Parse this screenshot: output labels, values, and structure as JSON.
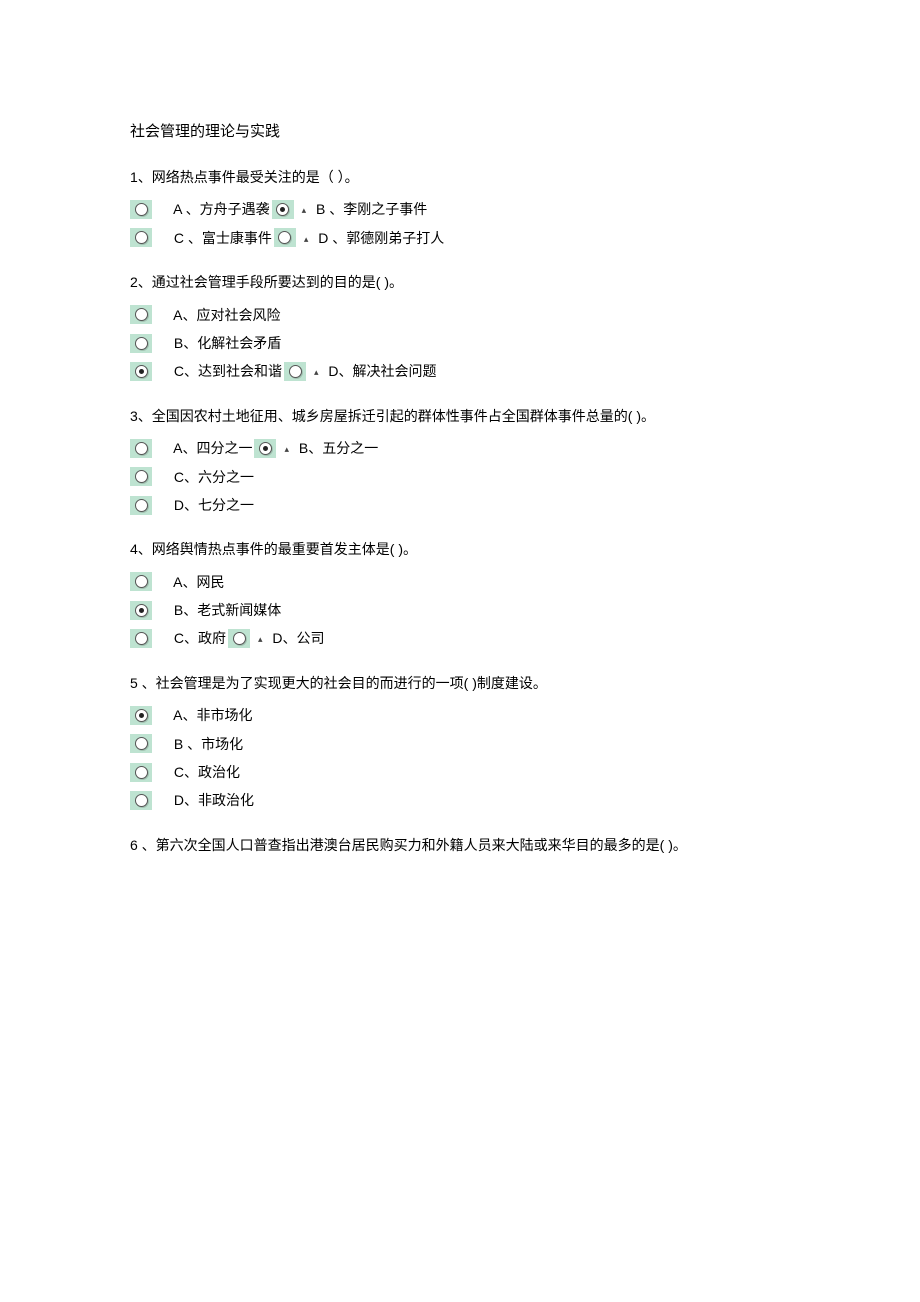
{
  "title": "社会管理的理论与实践",
  "q1": {
    "text": "1、网络热点事件最受关注的是（ ）。",
    "a": " A 、方舟子遇袭",
    "b": " B 、李刚之子事件",
    "c": " C 、富士康事件",
    "d": " D 、郭德刚弟子打人"
  },
  "q2": {
    "text": "2、通过社会管理手段所要达到的目的是( )。",
    "a": " A、应对社会风险",
    "b": " B、化解社会矛盾",
    "c": " C、达到社会和谐",
    "d": " D、解决社会问题"
  },
  "q3": {
    "text": "3、全国因农村土地征用、城乡房屋拆迁引起的群体性事件占全国群体事件总量的( )。",
    "a": " A、四分之一",
    "b": " B、五分之一",
    "c": " C、六分之一",
    "d": " D、七分之一"
  },
  "q4": {
    "text": "4、网络舆情热点事件的最重要首发主体是(   )。",
    "a": " A、网民",
    "b": " B、老式新闻媒体",
    "c": " C、政府",
    "d": " D、公司"
  },
  "q5": {
    "text": " 5 、社会管理是为了实现更大的社会目的而进行的一项(   )制度建设。",
    "a": " A、非市场化",
    "b": " B 、市场化",
    "c": " C、政治化",
    "d": " D、非政治化"
  },
  "q6": {
    "text": " 6 、第六次全国人口普查指出港澳台居民购买力和外籍人员来大陆或来华目的最多的是( )。"
  },
  "tri": "▴"
}
